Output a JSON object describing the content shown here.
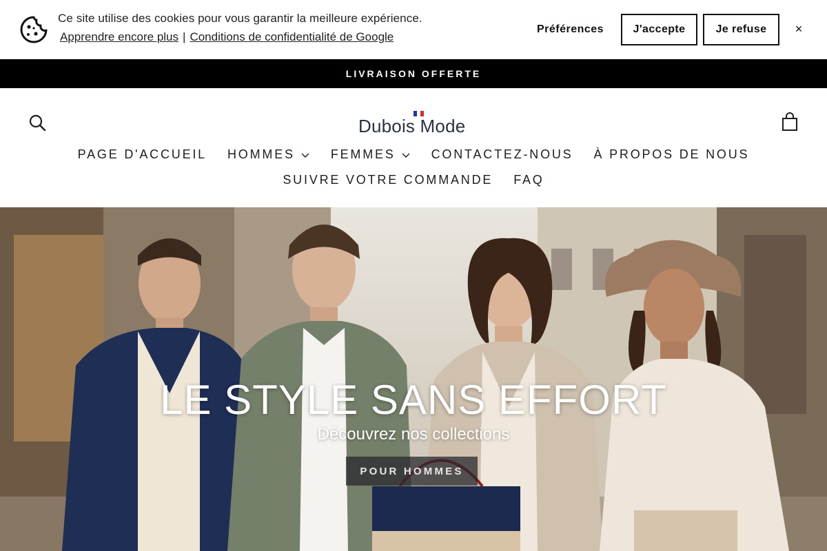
{
  "cookie_banner": {
    "message": "Ce site utilise des cookies pour vous garantir la meilleure expérience.",
    "learn_more_link": "Apprendre encore plus",
    "separator": "|",
    "privacy_link": "Conditions de confidentialité de Google",
    "preferences_label": "Préférences",
    "accept_label": "J'accepte",
    "refuse_label": "Je refuse",
    "close_symbol": "×",
    "icon": "cookie-icon"
  },
  "announcement": {
    "text": "LIVRAISON OFFERTE"
  },
  "header": {
    "logo_text": "Dubois Mode",
    "icons": {
      "search": "search-icon",
      "cart": "cart-icon"
    },
    "nav_row1": [
      {
        "label": "PAGE D'ACCUEIL",
        "has_dropdown": false
      },
      {
        "label": "HOMMES",
        "has_dropdown": true
      },
      {
        "label": "FEMMES",
        "has_dropdown": true
      },
      {
        "label": "CONTACTEZ-NOUS",
        "has_dropdown": false
      },
      {
        "label": "À PROPOS DE NOUS",
        "has_dropdown": false
      }
    ],
    "nav_row2": [
      {
        "label": "SUIVRE VOTRE COMMANDE",
        "has_dropdown": false
      },
      {
        "label": "FAQ",
        "has_dropdown": false
      }
    ]
  },
  "hero": {
    "title": "LE STYLE SANS EFFORT",
    "subtitle": "Découvrez nos collections",
    "button_label": "POUR HOMMES"
  },
  "colors": {
    "announcement_bg": "#000000",
    "logo": "#2a3344",
    "flag_blue": "#1f3a93",
    "flag_red": "#d32f2f"
  }
}
